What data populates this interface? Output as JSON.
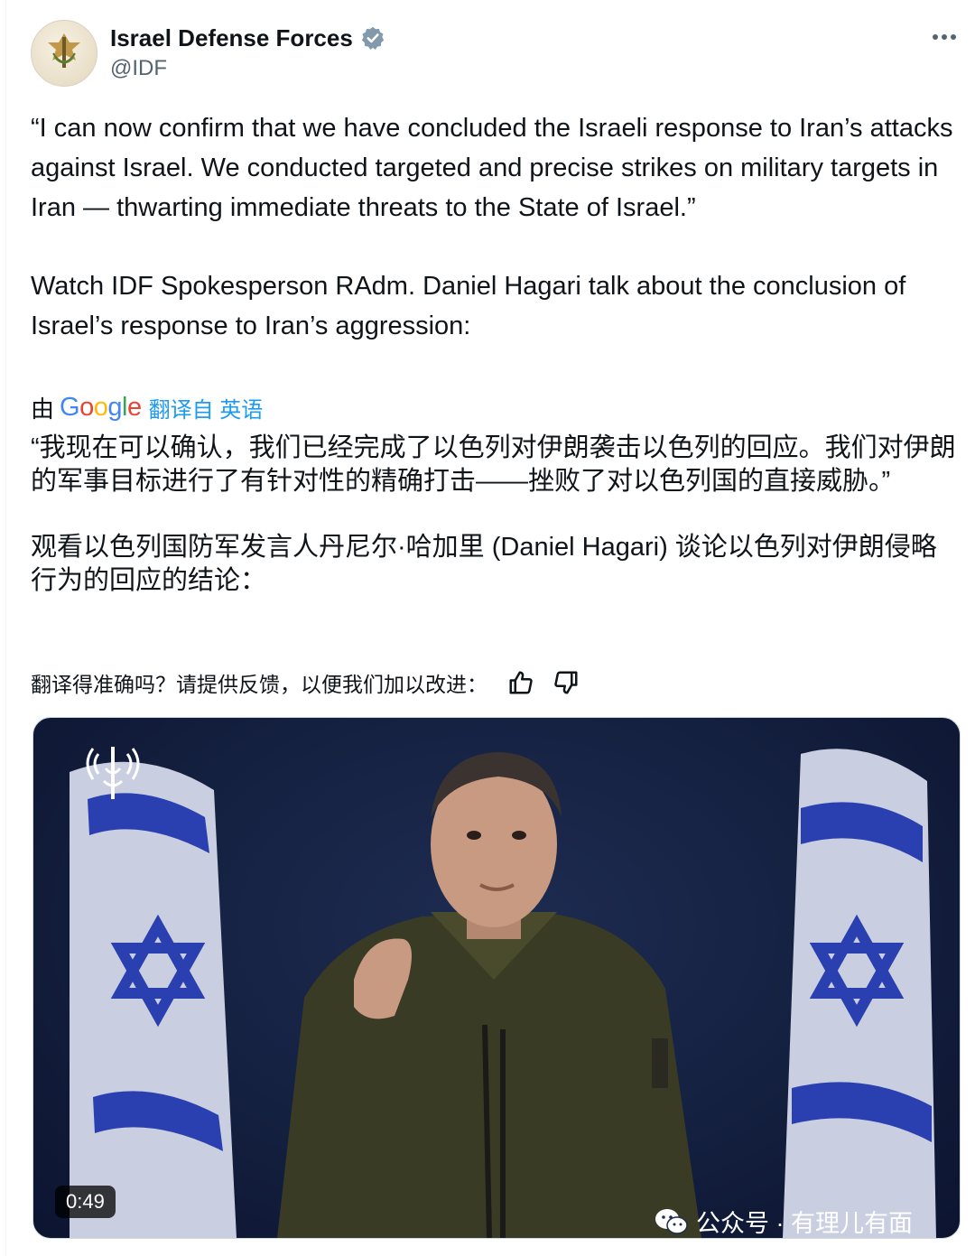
{
  "author": {
    "display_name": "Israel Defense Forces",
    "handle": "@IDF",
    "verified": true
  },
  "tweet": {
    "paragraphs": [
      "“I can now confirm that we have concluded the Israeli response to Iran’s attacks against Israel. We conducted targeted and precise strikes on military targets in Iran — thwarting immediate threats to the State of Israel.”",
      "Watch IDF Spokesperson RAdm. Daniel Hagari talk about the conclusion of Israel’s response to Iran’s aggression:"
    ]
  },
  "translation": {
    "by_label": "由",
    "provider": "Google",
    "link_label": "翻译自 英语",
    "paragraphs": [
      "“我现在可以确认，我们已经完成了以色列对伊朗袭击以色列的回应。我们对伊朗的军事目标进行了有针对性的精确打击——挫败了对以色列国的直接威胁。”",
      "观看以色列国防军发言人丹尼尔·哈加里 (Daniel Hagari) 谈论以色列对伊朗侵略行为的回应的结论："
    ],
    "feedback_prompt": "翻译得准确吗？请提供反馈，以便我们加以改进："
  },
  "video": {
    "duration": "0:49"
  },
  "watermark": {
    "text": "公众号 · 有理儿有面"
  },
  "colors": {
    "accent": "#1d9bf0",
    "secondary_text": "#536471",
    "flag_blue": "#2a3fb0"
  }
}
